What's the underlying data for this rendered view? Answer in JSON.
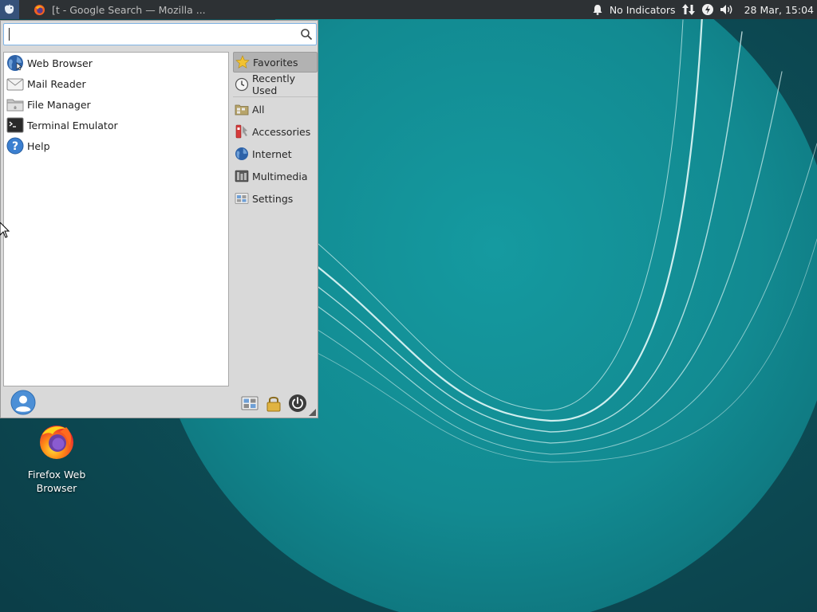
{
  "panel": {
    "task_title": "[t - Google Search — Mozilla ...",
    "indicator_text": "No Indicators",
    "clock": "28 Mar, 15:04",
    "icons": {
      "menu": "xfce-mouse-icon",
      "task": "firefox-icon",
      "notifications": "bell-icon",
      "network": "network-updown-icon",
      "power": "power-manager-icon",
      "volume": "speaker-icon"
    }
  },
  "whisker": {
    "search": {
      "value": "",
      "placeholder": ""
    },
    "favorites": [
      {
        "label": "Web Browser",
        "icon": "globe-icon"
      },
      {
        "label": "Mail Reader",
        "icon": "mail-icon"
      },
      {
        "label": "File Manager",
        "icon": "folder-icon"
      },
      {
        "label": "Terminal Emulator",
        "icon": "terminal-icon"
      },
      {
        "label": "Help",
        "icon": "help-icon"
      }
    ],
    "categories": [
      {
        "label": "Favorites",
        "icon": "star-icon",
        "active": true
      },
      {
        "label": "Recently Used",
        "icon": "clock-icon"
      },
      {
        "label": "All",
        "icon": "all-apps-icon"
      },
      {
        "label": "Accessories",
        "icon": "accessories-icon"
      },
      {
        "label": "Internet",
        "icon": "globe-icon"
      },
      {
        "label": "Multimedia",
        "icon": "multimedia-icon"
      },
      {
        "label": "Settings",
        "icon": "settings-icon"
      }
    ],
    "footer_icons": [
      "user-avatar-icon",
      "settings-manager-icon",
      "lock-screen-icon",
      "log-out-icon"
    ]
  },
  "desktop": {
    "icon_label_line1": "Firefox Web",
    "icon_label_line2": "Browser",
    "icon": "firefox-icon"
  },
  "colors": {
    "panel_bg": "#2d3134",
    "wallpaper_dark": "#0f4f57",
    "wallpaper_circle": "#138e95",
    "menu_bg": "#d9d9d9",
    "active_category": "#b2b2b2"
  }
}
